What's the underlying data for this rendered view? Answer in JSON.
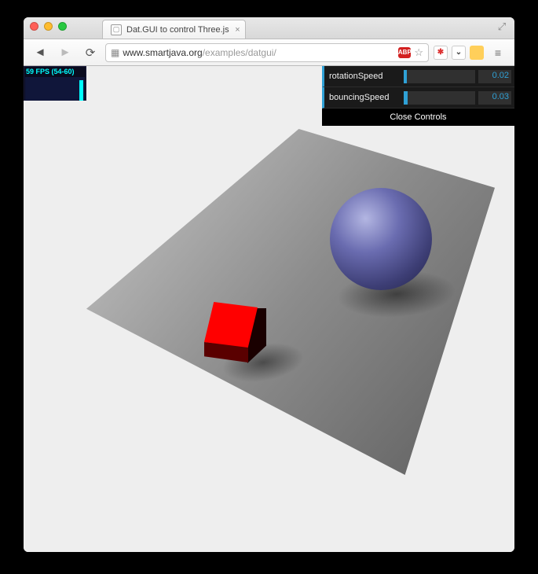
{
  "browser": {
    "tab_title": "Dat.GUI to control Three.js",
    "url_host": "www.smartjava.org",
    "url_path": "/examples/datgui/"
  },
  "stats": {
    "label": "59 FPS (54-60)"
  },
  "datgui": {
    "rows": [
      {
        "label": "rotationSpeed",
        "value": "0.02",
        "fillPercent": 4
      },
      {
        "label": "bouncingSpeed",
        "value": "0.03",
        "fillPercent": 6
      }
    ],
    "close_label": "Close Controls"
  },
  "scene": {
    "objects": [
      "plane",
      "red-cube",
      "blue-sphere"
    ],
    "colors": {
      "cube": "#ff0000",
      "sphere": "#6a6cb0",
      "plane": "#9a9a9a",
      "background": "#eeeeee"
    }
  }
}
